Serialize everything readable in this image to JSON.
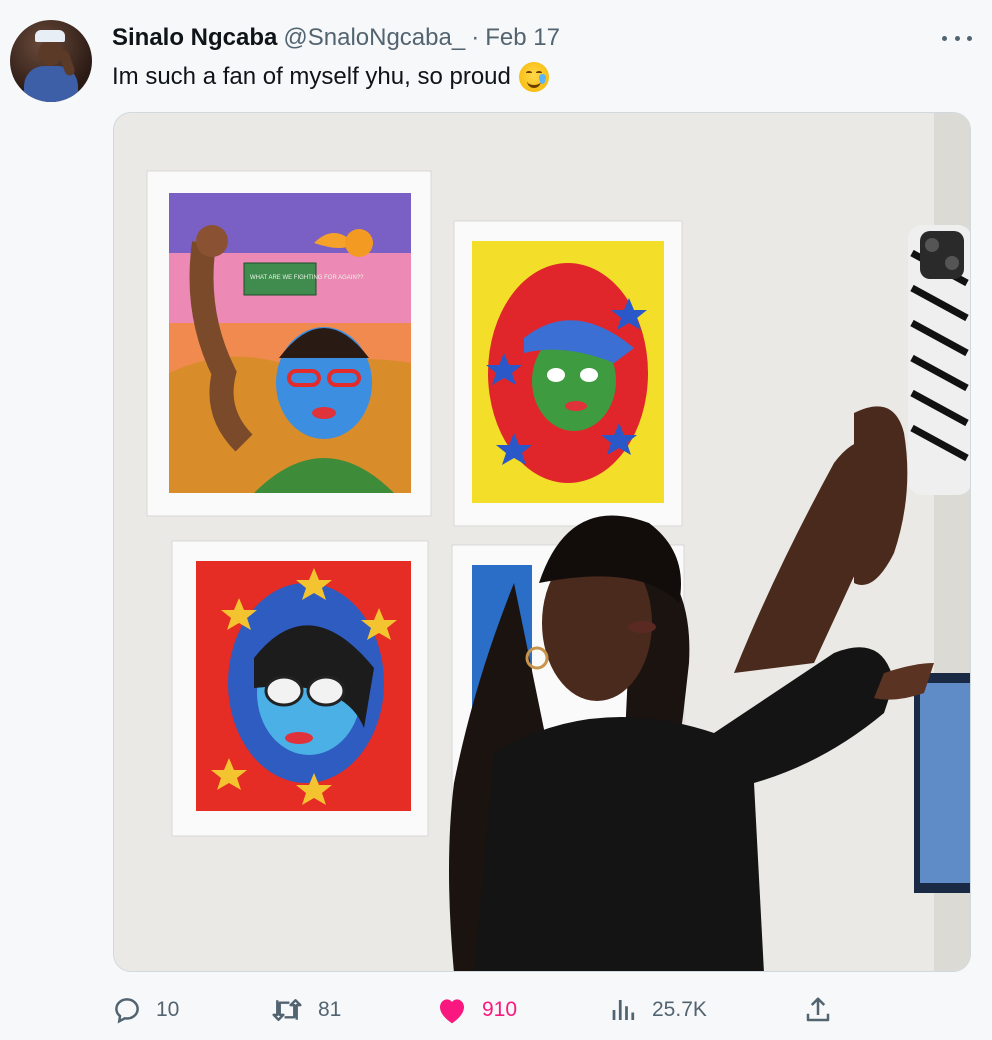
{
  "tweet": {
    "author_name": "Sinalo Ngcaba",
    "handle": "@SnaloNgcaba_",
    "separator": "·",
    "date": "Feb 17",
    "text": "Im such a fan of myself yhu, so proud",
    "emoji": "face-holding-back-tears",
    "art_caption": "WHAT ARE WE FIGHTING FOR AGAIN??"
  },
  "actions": {
    "replies": "10",
    "retweets": "81",
    "likes": "910",
    "views": "25.7K"
  },
  "icons": {
    "reply": "reply-icon",
    "retweet": "retweet-icon",
    "like": "heart-icon",
    "views": "views-icon",
    "share": "share-icon",
    "more": "more-icon"
  },
  "colors": {
    "like_active": "#f91880",
    "muted": "#536471",
    "text": "#0f1419"
  }
}
